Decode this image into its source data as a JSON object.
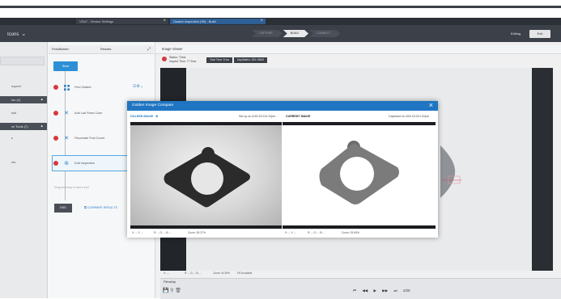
{
  "tabs": [
    {
      "label": "VSA7 - Sensor Settings"
    },
    {
      "label": "Gasket Inspection (99) - Build"
    }
  ],
  "appbar": {
    "menu_label": "Icons",
    "steps": [
      "CAPTURE",
      "BUILD",
      "CONNECT"
    ],
    "active_step": "BUILD",
    "editing_label": "Editing",
    "exit_label": "Exit"
  },
  "left_nav": {
    "items": [
      {
        "label": "nspect",
        "dark": false
      },
      {
        "label": "ion (1)",
        "dark": true
      },
      {
        "label": "ssit",
        "dark": false
      },
      {
        "label": "ce Tools (7)",
        "dark": true
      },
      {
        "label": "s",
        "dark": false
      },
      {
        "label": "nts",
        "dark": false
      }
    ]
  },
  "flow_panel": {
    "tab_flowbuilder": "FlowBuilder",
    "tab_results": "Results",
    "start_label": "Start",
    "steps": [
      {
        "label": "Find Gasket"
      },
      {
        "label": "Add Lab Fixed Color"
      },
      {
        "label": "Fluorinate Post Count"
      },
      {
        "label": "Edit Inspection"
      }
    ],
    "hint": "Drag and drop to add a tool",
    "end_label": "END",
    "compare_results": "COMPARE RESULTS"
  },
  "viewer": {
    "title": "Image Viewer",
    "status_line1": "Status: 70ms",
    "status_line2": "Inspect Time: 77.5ms",
    "chip1": "Total Time: 8 ms",
    "chip2": "Day/Matrix: 205 49849",
    "footer_x": "X: ---",
    "footer_rgb": "R: -- G: -- B: --",
    "footer_zoom": "Zoom: 94.39%",
    "footer_fit": "Fit Scrollable",
    "side_note": "Fit to Tool"
  },
  "filmstrip": {
    "label": "Filmstrip",
    "counter": "1/20"
  },
  "modal": {
    "title": "Golden Image Compare",
    "golden_label": "GOLDEN IMAGE",
    "golden_time": "Set up on 4/16 23:214 22pm",
    "current_label": "CURRENT IMAGE",
    "current_time": "Captured on 4/16 23:214 22pm",
    "golden_footer": {
      "x": "X: -- Y: --",
      "rgb": "R: -- G: -- B: --",
      "zoom": "Zoom: 28.37%"
    },
    "current_footer": {
      "x": "X: -- Y: --",
      "rgb": "R: -- G: -- B: --",
      "zoom": "Zoom: 25.65%"
    }
  },
  "colors": {
    "accent": "#1f75c2",
    "start_button": "#2d8fd6",
    "error_dot": "#d8393c",
    "topbar": "#3c4048"
  }
}
